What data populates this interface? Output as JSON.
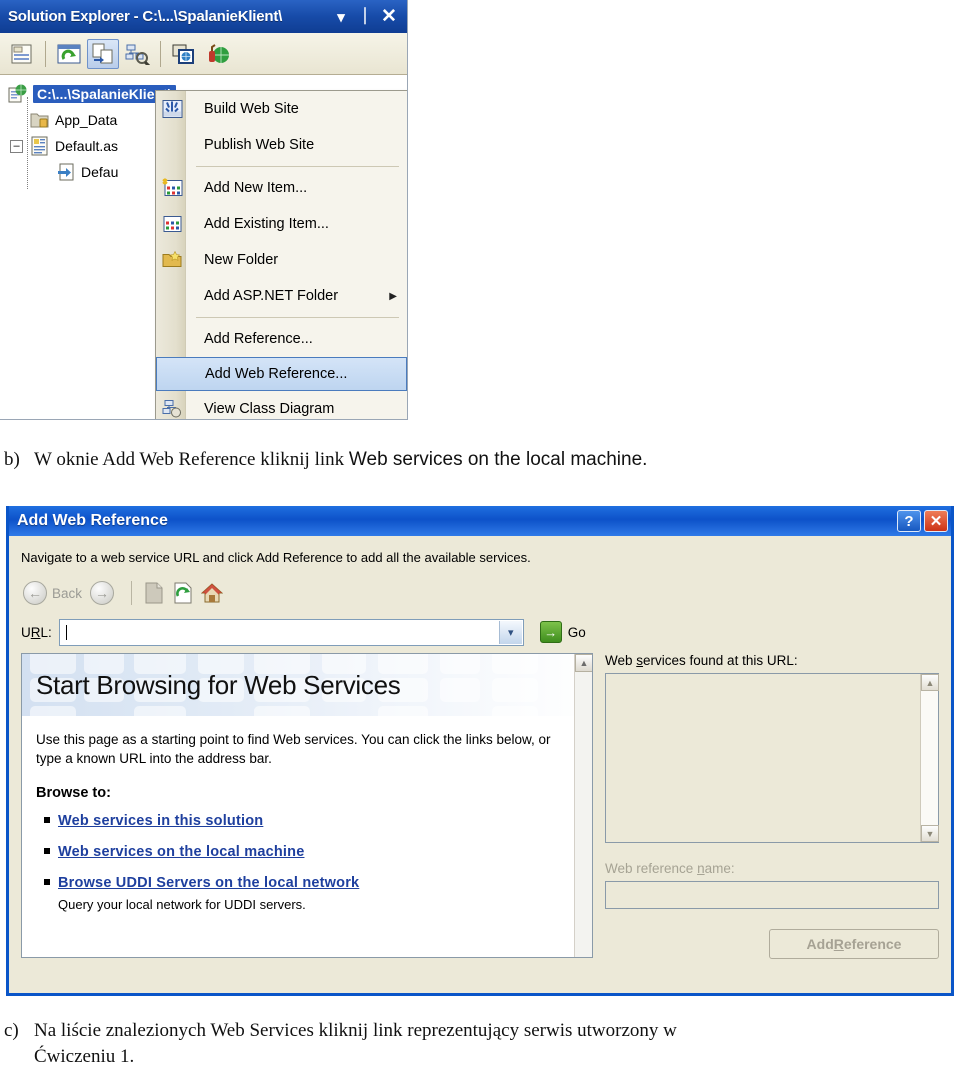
{
  "solution_explorer": {
    "title": "Solution Explorer - C:\\...\\SpalanieKlient\\",
    "titlebar_buttons": [
      {
        "name": "dropdown",
        "glyph": "▾"
      },
      {
        "name": "pin",
        "glyph": "⏐"
      },
      {
        "name": "close",
        "glyph": "✕"
      }
    ],
    "toolbar_icons": [
      "properties-icon",
      "refresh-icon",
      "show-all-files-icon",
      "class-view-icon",
      "copy-website-icon",
      "aspnet-config-icon"
    ],
    "tree": [
      {
        "label": "C:\\...\\SpalanieKlient\\",
        "icon": "website-icon",
        "level": 0,
        "selected": true
      },
      {
        "label": "App_Data",
        "icon": "folder-data-icon",
        "level": 1,
        "selected": false
      },
      {
        "label": "Default.as",
        "icon": "aspx-page-icon",
        "level": 1,
        "selected": false
      },
      {
        "label": "Defau",
        "icon": "code-file-icon",
        "level": 2,
        "selected": false
      }
    ],
    "context_menu": [
      {
        "label": "Build Web Site",
        "icon": "build-icon",
        "type": "item",
        "selected": false,
        "submenu": false
      },
      {
        "label": "Publish Web Site",
        "icon": "",
        "type": "item",
        "selected": false,
        "submenu": false
      },
      {
        "type": "separator"
      },
      {
        "label": "Add New Item...",
        "icon": "add-new-item-icon",
        "type": "item",
        "selected": false,
        "submenu": false
      },
      {
        "label": "Add Existing Item...",
        "icon": "add-existing-item-icon",
        "type": "item",
        "selected": false,
        "submenu": false
      },
      {
        "label": "New Folder",
        "icon": "new-folder-icon",
        "type": "item",
        "selected": false,
        "submenu": false
      },
      {
        "label": "Add ASP.NET Folder",
        "icon": "",
        "type": "item",
        "selected": false,
        "submenu": true,
        "arrow": "▶"
      },
      {
        "type": "separator"
      },
      {
        "label": "Add Reference...",
        "icon": "",
        "type": "item",
        "selected": false,
        "submenu": false
      },
      {
        "label": "Add Web Reference...",
        "icon": "",
        "type": "item",
        "selected": true,
        "submenu": false
      },
      {
        "label": "View Class Diagram",
        "icon": "class-diagram-icon",
        "type": "item",
        "selected": false,
        "submenu": false
      }
    ]
  },
  "caption_b": {
    "marker": "b)",
    "part1": "W oknie Add Web Reference ",
    "part2": "kliknij link ",
    "part3": "Web services on the local machine."
  },
  "caption_c": {
    "marker": "c)",
    "line1": "Na liście znalezionych Web Services kliknij link reprezentujący serwis utworzony w",
    "line2": "Ćwiczeniu 1."
  },
  "dialog": {
    "title": "Add Web Reference",
    "help_button": "?",
    "close_button": "✕",
    "instruction": "Navigate to a web service URL and click Add Reference to add all the available services.",
    "nav": {
      "back_label": "Back",
      "back_glyph": "←",
      "forward_glyph": "→",
      "stop_icon": "stop-icon",
      "refresh_icon": "refresh-icon",
      "home_icon": "home-icon"
    },
    "url": {
      "label_pre": "U",
      "label_accel": "R",
      "label_post": "L:",
      "value": "",
      "placeholder": "",
      "dropdown_glyph": "▾",
      "go_label": "Go",
      "go_glyph": "→"
    },
    "browser": {
      "heading": "Start Browsing for Web Services",
      "intro": "Use this page as a starting point to find Web services. You can click the links below, or type a known URL into the address bar.",
      "browse_to_label": "Browse to:",
      "links": [
        {
          "text": "Web services in this solution",
          "sub": ""
        },
        {
          "text": "Web services on the local machine",
          "sub": ""
        },
        {
          "text": "Browse UDDI Servers on the local network",
          "sub": "Query your local network for UDDI servers."
        }
      ],
      "scroll_up_glyph": "▲"
    },
    "right": {
      "found_label_pre": "Web ",
      "found_label_accel": "s",
      "found_label_post": "ervices found at this URL:",
      "list_items": [],
      "refname_label_pre": "Web reference ",
      "refname_label_accel": "n",
      "refname_label_post": "ame:",
      "refname_value": "",
      "add_ref_pre": "Add ",
      "add_ref_accel": "R",
      "add_ref_post": "eference",
      "scroll_up_glyph": "▲",
      "scroll_down_glyph": "▼"
    }
  },
  "colors": {
    "title_blue": "#0d52c9",
    "selection_blue": "#2a5dbd",
    "dialog_face": "#ece9d8",
    "link_blue": "#1e3f9e",
    "go_green": "#3f8e1e",
    "close_red": "#cc3316"
  }
}
